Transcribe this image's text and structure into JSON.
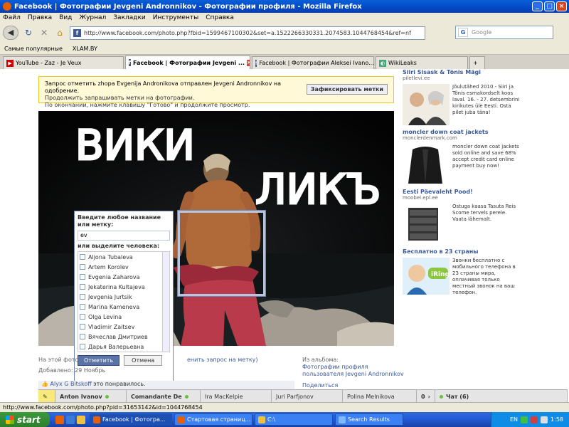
{
  "window": {
    "title": "Facebook | Фотографии Jevgeni Andronnikov - Фотографии профиля - Mozilla Firefox",
    "controls": [
      "_",
      "□",
      "×"
    ]
  },
  "menu": [
    "Файл",
    "Правка",
    "Вид",
    "Журнал",
    "Закладки",
    "Инструменты",
    "Справка"
  ],
  "nav": {
    "url": "http://www.facebook.com/photo.php?fbid=1599467100302&set=a.1522266330331.2074583.1044768454&ref=nf",
    "search_placeholder": "Google"
  },
  "bookmarks": [
    "Самые популярные",
    "XLAM.BY"
  ],
  "tabs": [
    {
      "label": "YouTube - Zaz - Je Veux",
      "active": false
    },
    {
      "label": "Facebook | Фотографии Jevgeni ...",
      "active": true
    },
    {
      "label": "Facebook | Фотографии Aleksei Ivano...",
      "active": false
    },
    {
      "label": "WikiLeaks",
      "active": false
    }
  ],
  "tag_request": {
    "message": "Запрос отметить zhopa Evgenija Andronikova отправлен Jevgeni Andronnikov на одобрение.",
    "hint1": "Продолжить запрашивать метки на фотографии.",
    "hint2": "По окончании, нажмите клавишу \"Готово\" и продолжите просмотр.",
    "button": "Зафиксировать метки"
  },
  "photo": {
    "drawn_text_1": "ВИКИ",
    "drawn_text_2": "ЛИКЪ"
  },
  "tag_panel": {
    "label": "Введите любое название или метку:",
    "input_value": "ev",
    "choose_label": "или выделите человека:",
    "people": [
      "Aljona Tubaleva",
      "Artem Korolev",
      "Evgenia Zaharova",
      "Jekaterina Kultajeva",
      "Jevgenia Jurtsik",
      "Marina Kameneva",
      "Olga Levina",
      "Vladimir Zaitsev",
      "Вячеслав Дмитриев",
      "Дарья Валерьевна"
    ],
    "confirm": "Отметить",
    "cancel": "Отмена"
  },
  "photo_meta": {
    "on_photo": "На этой фото",
    "remove_link": "енить запрос на метку)",
    "added": "Добавлено: 29 Ноябрь",
    "album_label": "Из альбома:",
    "album_name": "Фотографии профиля",
    "album_owner": "пользователя Jevgeni Andronnikov",
    "share": "Поделиться",
    "likes_name": "Alyx G Bitskoff",
    "likes_text": "это понравилось."
  },
  "ads": [
    {
      "title": "Siiri Sisask & Tõnis Mägi",
      "url": "piletlevi.ee",
      "text": "Jõulutähed 2010 - Siiri ja Tõnis esmakordselt koos laval. 16. - 27. detsembrini kirikutes üle Eesti. Osta pilet juba täna!"
    },
    {
      "title": "moncler down coat jackets",
      "url": "monclerdenmark.com",
      "text": "moncler down coat jackets sold online and save 68% accept credit card online payment buy now!"
    },
    {
      "title": "Eesti Päevaleht Pood!",
      "url": "moobel.epl.ee",
      "text": "Ostuga kaasa Tasuta Reis Scome tervels perele. Vaata lähemalt."
    },
    {
      "title": "Бесплатно в 23 страны",
      "url": "",
      "text": "Звонки бесплатно с мобильного телефона в 23 страны мира, оплачивая только местный звонок на ваш телефон."
    }
  ],
  "chat": {
    "friends": [
      "Anton Ivanov",
      "Comandante De",
      "Ira MacKelpie",
      "Juri Parfjonov",
      "Polina Melnikova"
    ],
    "counter": "0",
    "label": "Чат (6)"
  },
  "status": "http://www.facebook.com/photo.php?pid=31653142&id=1044768454",
  "taskbar": {
    "start": "start",
    "items": [
      "Facebook | Фотогра...",
      "Стартовая страниц...",
      "C:\\",
      "Search Results"
    ],
    "lang": "EN",
    "clock": "1:58"
  }
}
